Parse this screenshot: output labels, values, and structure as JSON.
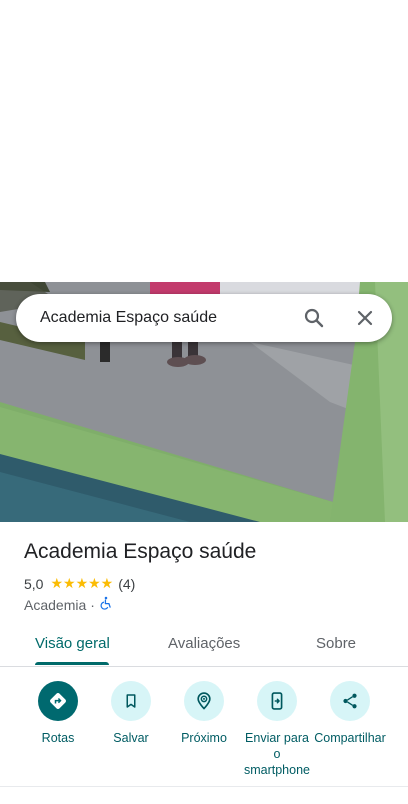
{
  "search": {
    "query": "Academia Espaço saúde",
    "search_icon": "search-icon",
    "close_icon": "close-icon"
  },
  "photo": {
    "subject": "gym interior photo"
  },
  "place": {
    "name": "Academia Espaço saúde",
    "rating": "5,0",
    "stars_filled": 5,
    "review_count": "(4)",
    "category": "Academia",
    "separator": "·",
    "accessibility_icon": "wheelchair-icon"
  },
  "tabs": [
    {
      "label": "Visão geral",
      "active": true
    },
    {
      "label": "Avaliações",
      "active": false
    },
    {
      "label": "Sobre",
      "active": false
    }
  ],
  "actions": [
    {
      "label": "Rotas",
      "icon": "directions-icon"
    },
    {
      "label": "Salvar",
      "icon": "bookmark-icon"
    },
    {
      "label": "Próximo",
      "icon": "nearby-icon"
    },
    {
      "label": "Enviar para o smartphone",
      "icon": "send-to-phone-icon"
    },
    {
      "label": "Compartilhar",
      "icon": "share-icon"
    }
  ],
  "colors": {
    "accent": "#006a6a",
    "action_bg": "#d7f5f7",
    "primary_action_bg": "#00696f",
    "star": "#fbbc04",
    "accessibility": "#1a73e8"
  }
}
